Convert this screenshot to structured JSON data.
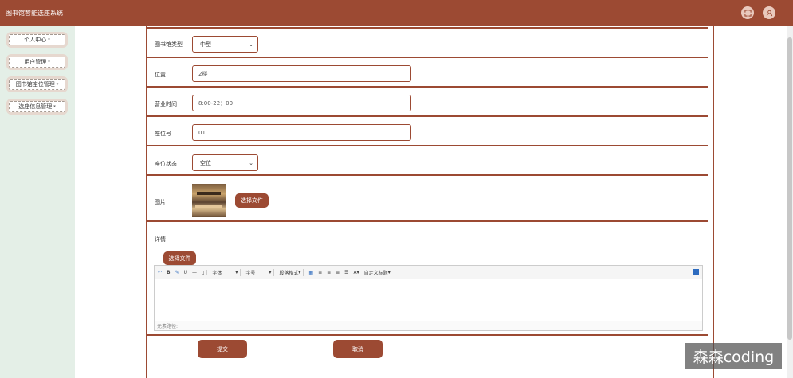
{
  "app": {
    "title": "图书馆智能选座系统"
  },
  "sidebar": {
    "items": [
      {
        "label": "个人中心"
      },
      {
        "label": "用户管理"
      },
      {
        "label": "图书馆座位管理"
      },
      {
        "label": "选座信息管理"
      }
    ]
  },
  "form": {
    "library_type": {
      "label": "图书馆类型",
      "value": "中型"
    },
    "location": {
      "label": "位置",
      "value": "2楼"
    },
    "hours": {
      "label": "营业时间",
      "value": "8:00-22：00"
    },
    "seat_no": {
      "label": "座位号",
      "value": "01"
    },
    "seat_status": {
      "label": "座位状态",
      "value": "空位"
    },
    "image": {
      "label": "图片",
      "choose_file": "选择文件"
    },
    "details": {
      "label": "详情",
      "choose_file": "选择文件"
    },
    "submit": "提交",
    "cancel": "取消"
  },
  "editor": {
    "toolbar": {
      "bold": "B",
      "underline": "U",
      "font_family": "字体",
      "font_size": "字号",
      "paragraph": "段落格式",
      "font_color": "A",
      "custom_title": "自定义标题"
    },
    "status": "元素路径:"
  },
  "watermark": "森森coding",
  "colors": {
    "brand": "#9c4a33",
    "sidebar_bg": "#e4efe7"
  }
}
